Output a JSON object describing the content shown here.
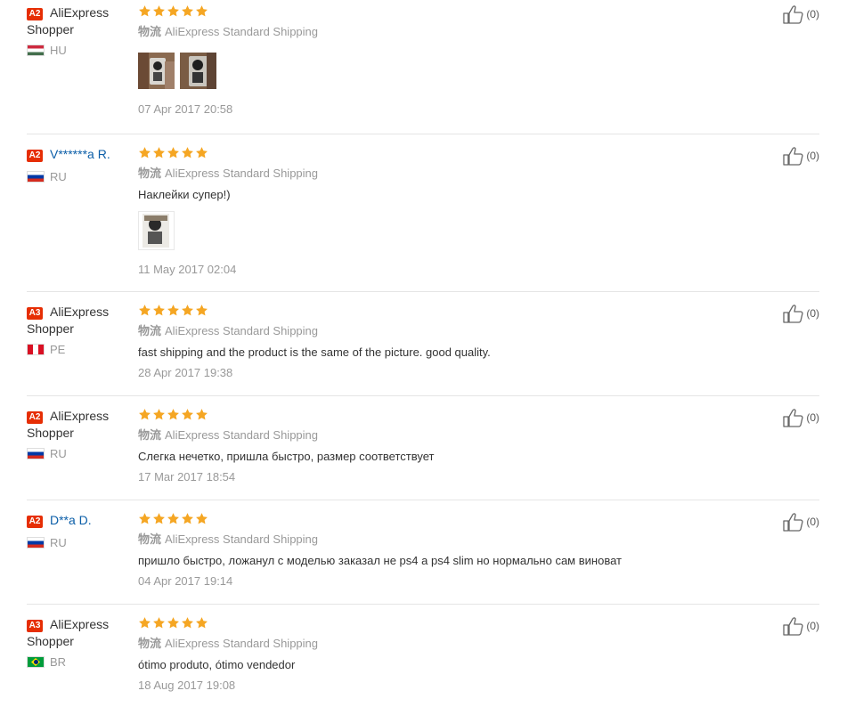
{
  "shipping_label": "物流",
  "reviews": [
    {
      "badge": "A2",
      "name_line1": "AliExpress",
      "name_line2": "Shopper",
      "country": "HU",
      "flag": "hu",
      "shipping": "AliExpress Standard Shipping",
      "text": "",
      "date": "07 Apr 2017 20:58",
      "helpful": "(0)",
      "photos": 2
    },
    {
      "badge": "A2",
      "name_line1": "V******a R.",
      "name_line2": "",
      "country": "RU",
      "flag": "ru",
      "shipping": "AliExpress Standard Shipping",
      "text": "Наклейки супер!)",
      "date": "11 May 2017 02:04",
      "helpful": "(0)",
      "photos": 1
    },
    {
      "badge": "A3",
      "name_line1": "AliExpress",
      "name_line2": "Shopper",
      "country": "PE",
      "flag": "pe",
      "shipping": "AliExpress Standard Shipping",
      "text": "fast shipping and the product is the same of the picture. good quality.",
      "date": "28 Apr 2017 19:38",
      "helpful": "(0)",
      "photos": 0
    },
    {
      "badge": "A2",
      "name_line1": "AliExpress",
      "name_line2": "Shopper",
      "country": "RU",
      "flag": "ru",
      "shipping": "AliExpress Standard Shipping",
      "text": "Слегка нечетко, пришла быстро, размер соответствует",
      "date": "17 Mar 2017 18:54",
      "helpful": "(0)",
      "photos": 0
    },
    {
      "badge": "A2",
      "name_line1": "D**a D.",
      "name_line2": "",
      "country": "RU",
      "flag": "ru",
      "shipping": "AliExpress Standard Shipping",
      "text": "пришло быстро, ложанул с моделью заказал не ps4 а ps4 slim но нормально сам виноват",
      "date": "04 Apr 2017 19:14",
      "helpful": "(0)",
      "photos": 0
    },
    {
      "badge": "A3",
      "name_line1": "AliExpress",
      "name_line2": "Shopper",
      "country": "BR",
      "flag": "br",
      "shipping": "AliExpress Standard Shipping",
      "text": "ótimo produto, ótimo vendedor",
      "date": "18 Aug 2017 19:08",
      "helpful": "(0)",
      "photos": 0
    }
  ],
  "rating": 5,
  "colors": {
    "badge": "#e62e04",
    "star": "#f5a623",
    "link": "#0b5ea8"
  }
}
